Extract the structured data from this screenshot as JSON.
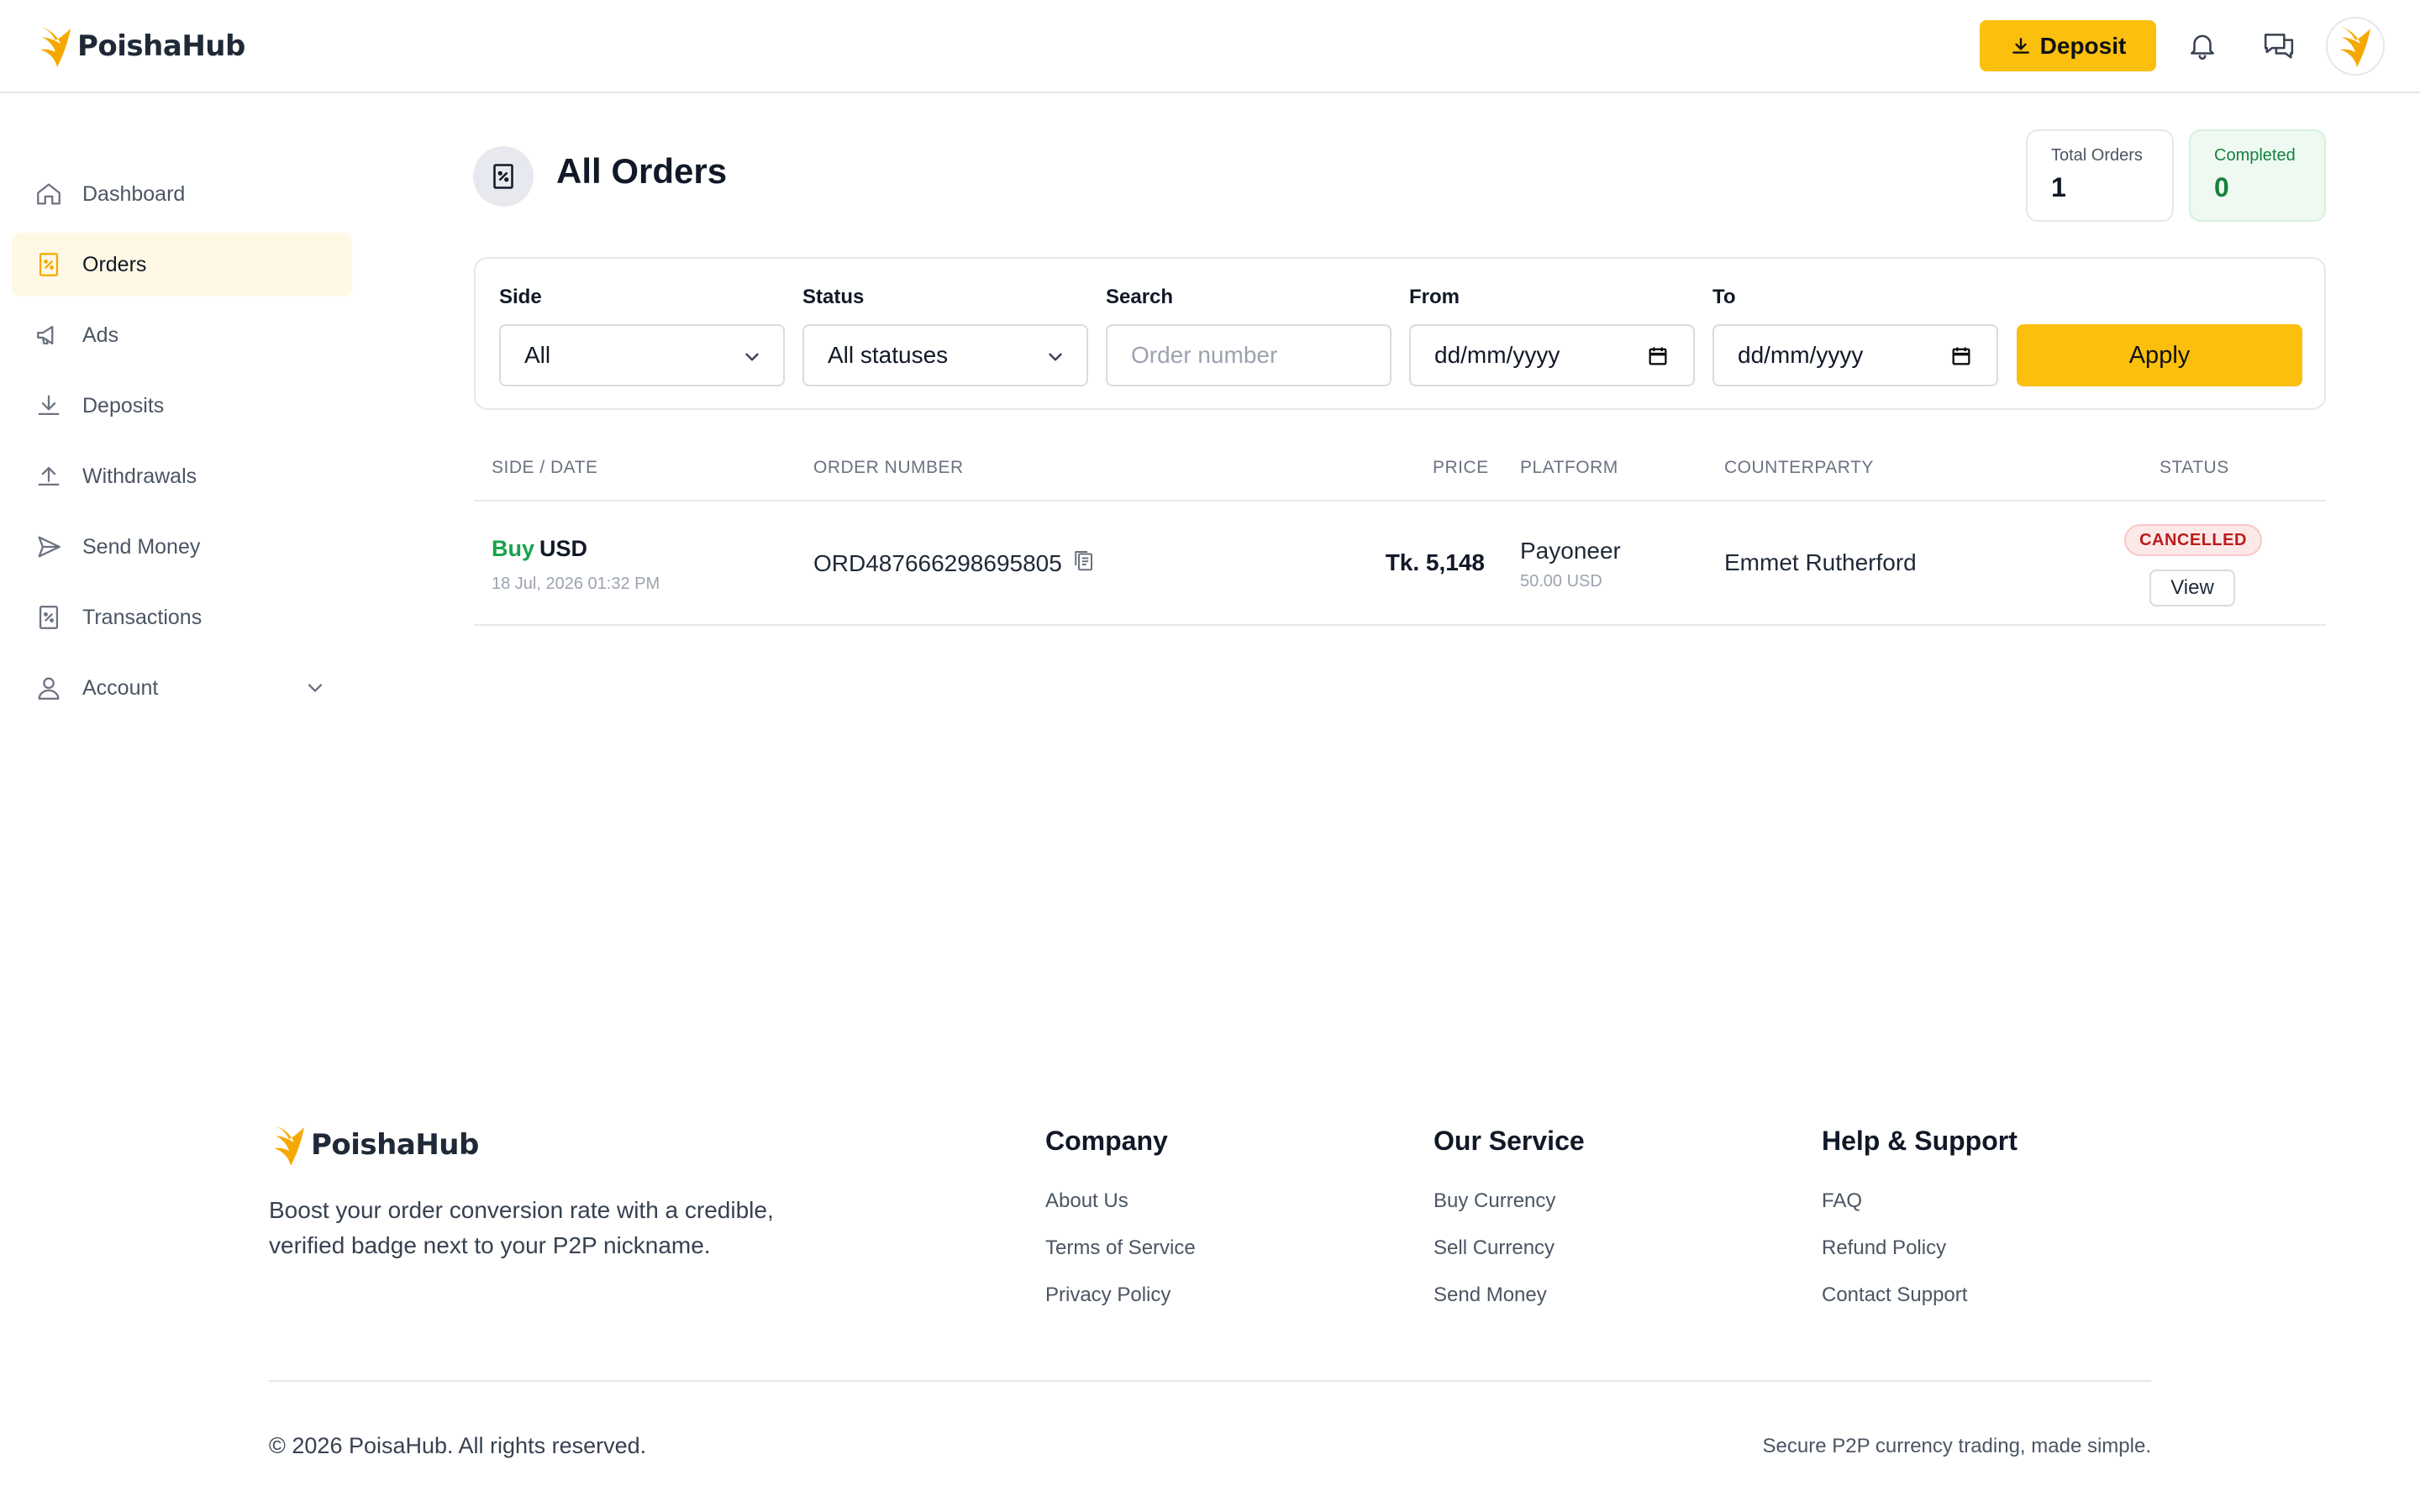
{
  "brand": {
    "name": "PoishaHub",
    "accent": "#fbbf0e"
  },
  "header": {
    "deposit_label": "Deposit"
  },
  "sidebar": {
    "items": [
      {
        "label": "Dashboard",
        "icon": "home-icon"
      },
      {
        "label": "Orders",
        "icon": "receipt-icon",
        "active": true
      },
      {
        "label": "Ads",
        "icon": "megaphone-icon"
      },
      {
        "label": "Deposits",
        "icon": "download-icon"
      },
      {
        "label": "Withdrawals",
        "icon": "upload-icon"
      },
      {
        "label": "Send Money",
        "icon": "send-icon"
      },
      {
        "label": "Transactions",
        "icon": "receipt-icon"
      },
      {
        "label": "Account",
        "icon": "user-icon",
        "expandable": true
      }
    ]
  },
  "page": {
    "title": "All Orders"
  },
  "stats": {
    "total_label": "Total Orders",
    "total_value": "1",
    "completed_label": "Completed",
    "completed_value": "0"
  },
  "filters": {
    "side_label": "Side",
    "side_value": "All",
    "status_label": "Status",
    "status_value": "All statuses",
    "search_label": "Search",
    "search_placeholder": "Order number",
    "from_label": "From",
    "from_value": "dd/mm/yyyy",
    "to_label": "To",
    "to_value": "dd/mm/yyyy",
    "apply_label": "Apply"
  },
  "table": {
    "headers": [
      "SIDE / DATE",
      "ORDER NUMBER",
      "PRICE",
      "PLATFORM",
      "COUNTERPARTY",
      "STATUS"
    ],
    "rows": [
      {
        "side": "Buy",
        "currency": "USD",
        "date": "18 Jul, 2026 01:32 PM",
        "order_number": "ORD487666298695805",
        "price": "Tk. 5,148",
        "platform": "Payoneer",
        "platform_amount": "50.00 USD",
        "counterparty": "Emmet Rutherford",
        "status": "CANCELLED",
        "action": "View"
      }
    ]
  },
  "footer": {
    "brand": "PoishaHub",
    "tagline": "Boost your order conversion rate with a credible, verified badge next to your P2P nickname.",
    "columns": [
      {
        "title": "Company",
        "links": [
          "About Us",
          "Terms of Service",
          "Privacy Policy"
        ]
      },
      {
        "title": "Our Service",
        "links": [
          "Buy Currency",
          "Sell Currency",
          "Send Money"
        ]
      },
      {
        "title": "Help & Support",
        "links": [
          "FAQ",
          "Refund Policy",
          "Contact Support"
        ]
      }
    ],
    "copyright": "© 2026 PoisaHub. All rights reserved.",
    "slogan": "Secure P2P currency trading, made simple."
  }
}
